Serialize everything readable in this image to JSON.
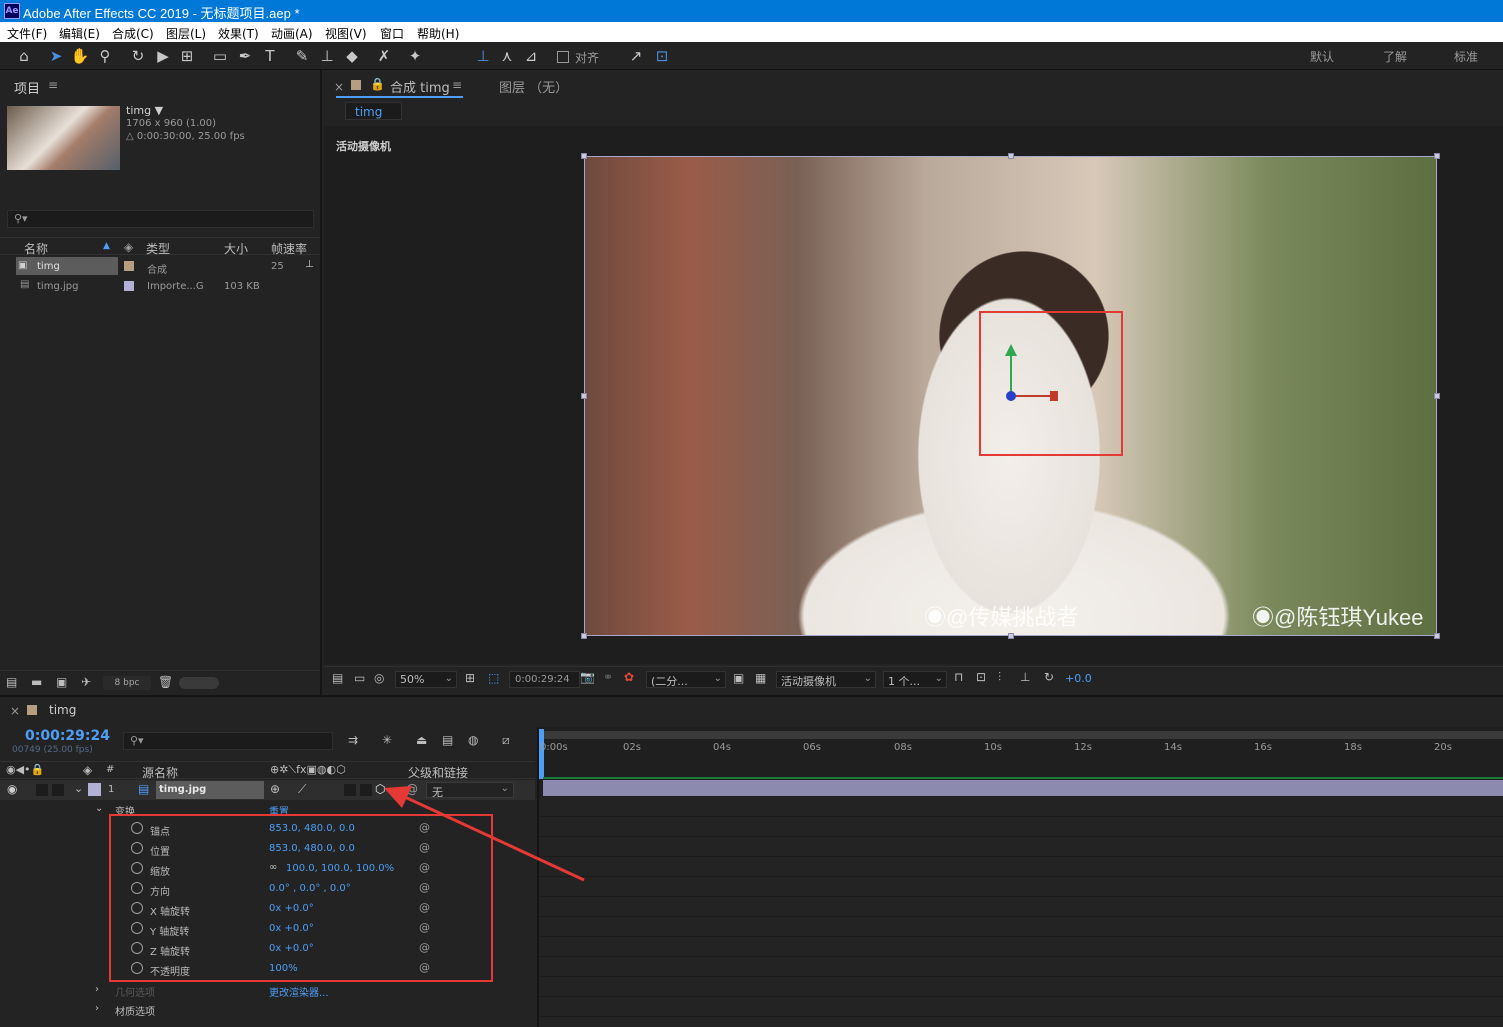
{
  "app": {
    "window_title": "Adobe After Effects CC 2019 - 无标题项目.aep *",
    "logo": "Ae"
  },
  "menu": [
    "文件(F)",
    "编辑(E)",
    "合成(C)",
    "图层(L)",
    "效果(T)",
    "动画(A)",
    "视图(V)",
    "窗口",
    "帮助(H)"
  ],
  "toolbar": {
    "align_label": "对齐",
    "workspaces": [
      "默认",
      "了解",
      "标准"
    ]
  },
  "project": {
    "title": "项目",
    "item_name": "timg ▼",
    "item_size": "1706 x 960 (1.00)",
    "item_duration": "△ 0:00:30:00, 25.00 fps",
    "columns": [
      "名称",
      "类型",
      "大小",
      "帧速率"
    ],
    "rows": [
      {
        "name": "timg",
        "type": "合成",
        "size": "",
        "fps": "25"
      },
      {
        "name": "timg.jpg",
        "type": "Importe...G",
        "size": "103 KB",
        "fps": ""
      }
    ],
    "bpc": "8 bpc"
  },
  "comp": {
    "tab_label": "合成 timg",
    "tab_comp_name": "timg",
    "layer_tab": "图层 （无）",
    "breadcrumb": "timg",
    "camera_label": "活动摄像机",
    "watermarks": [
      "@传媒挑战者",
      "@陈钰琪Yukee"
    ],
    "footer": {
      "zoom": "50%",
      "timecode": "0:00:29:24",
      "resolution": "(二分...",
      "camera": "活动摄像机",
      "views": "1 个...",
      "exposure": "+0.0"
    }
  },
  "timeline": {
    "tab": "timg",
    "timecode": "0:00:29:24",
    "frame_info": "00749 (25.00 fps)",
    "col_source": "源名称",
    "col_parent": "父级和链接",
    "layer": {
      "index": "1",
      "name": "timg.jpg",
      "parent": "无"
    },
    "transform": {
      "label": "变换",
      "reset": "重置"
    },
    "properties": [
      {
        "name": "锚点",
        "value": "853.0, 480.0, 0.0"
      },
      {
        "name": "位置",
        "value": "853.0, 480.0, 0.0"
      },
      {
        "name": "缩放",
        "value": "100.0, 100.0, 100.0%"
      },
      {
        "name": "方向",
        "value": "0.0° , 0.0° , 0.0°"
      },
      {
        "name": "X 轴旋转",
        "value": "0x +0.0°"
      },
      {
        "name": "Y 轴旋转",
        "value": "0x +0.0°"
      },
      {
        "name": "Z 轴旋转",
        "value": "0x +0.0°"
      },
      {
        "name": "不透明度",
        "value": "100%"
      }
    ],
    "geometry_label": "几何选项",
    "geometry_value": "更改渲染器...",
    "material_label": "材质选项",
    "ruler": [
      "0:00s",
      "02s",
      "04s",
      "06s",
      "08s",
      "10s",
      "12s",
      "14s",
      "16s",
      "18s",
      "20s"
    ]
  },
  "colors": {
    "accent": "#4d9ef6",
    "annotation": "#e53935",
    "titlebar": "#0078d7"
  }
}
